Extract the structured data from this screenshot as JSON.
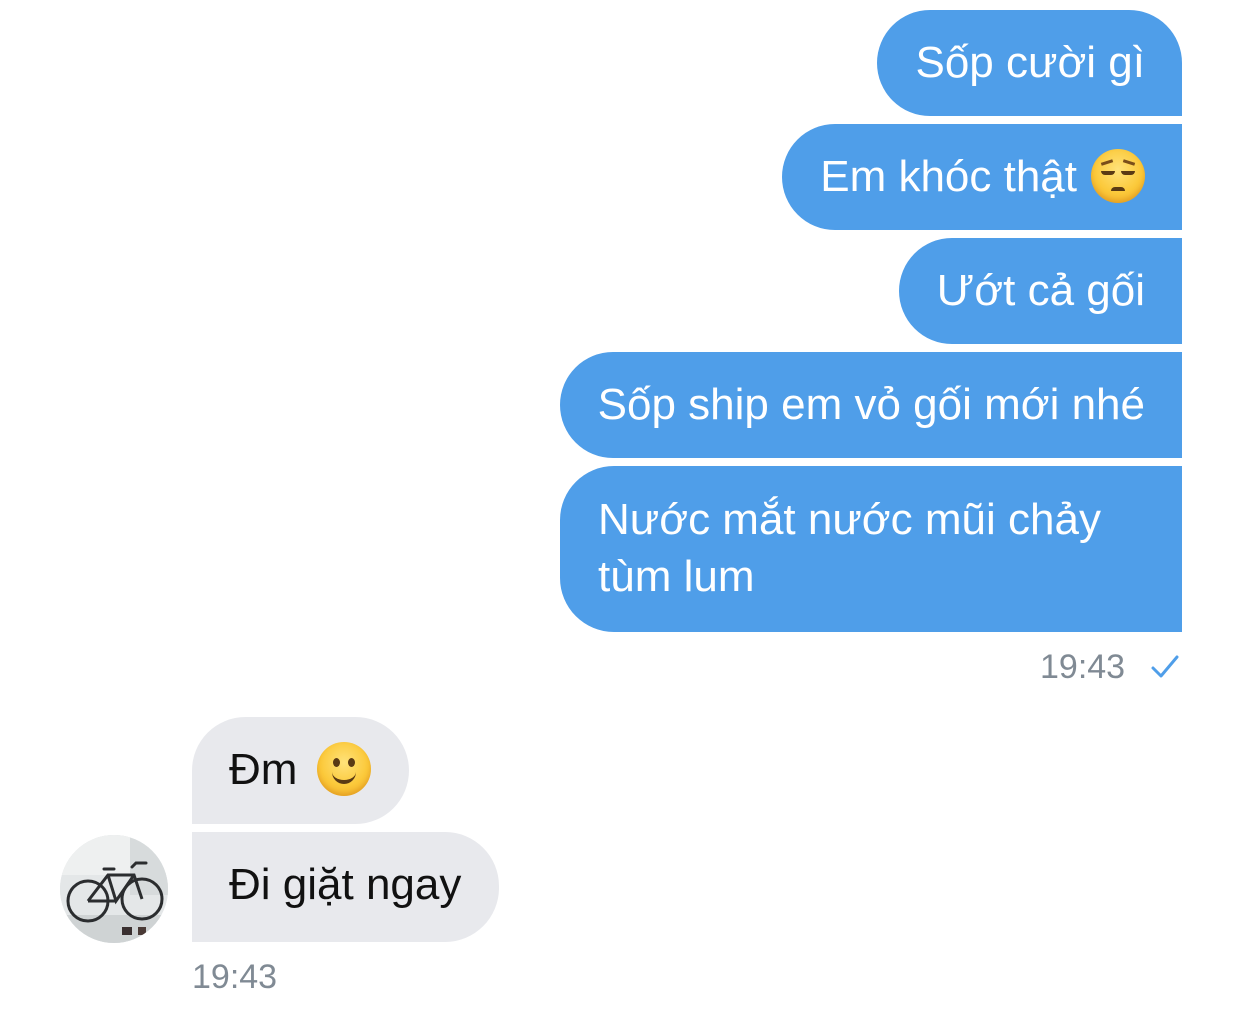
{
  "outgoing_messages": [
    {
      "text": "Sốp cười gì"
    },
    {
      "text": "Em khóc thật",
      "emoji": "pensive-face-emoji"
    },
    {
      "text": "Ướt cả gối"
    },
    {
      "text": "Sốp ship em vỏ gối mới nhé"
    },
    {
      "text": "Nước mắt nước mũi chảy tùm lum"
    }
  ],
  "outgoing_time": "19:43",
  "outgoing_status": "sent-check-icon",
  "incoming_messages": [
    {
      "text": "Đm",
      "emoji": "slightly-smiling-face-emoji"
    },
    {
      "text": "Đi giặt ngay"
    }
  ],
  "incoming_time": "19:43",
  "sender_avatar": "bicycle-photo-avatar",
  "colors": {
    "outgoing_bubble": "#4f9ee9",
    "incoming_bubble": "#e8e9ed",
    "timestamp": "#808a94",
    "check": "#4f9ee9"
  }
}
